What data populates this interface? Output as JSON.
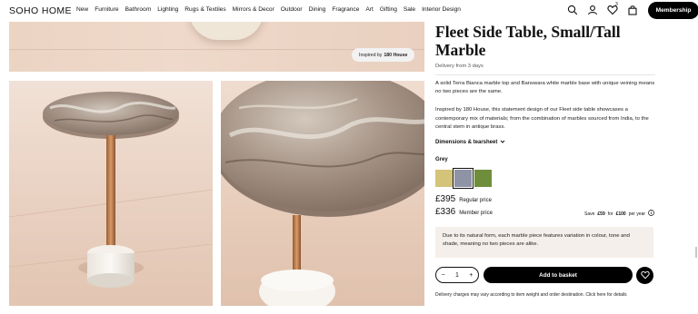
{
  "brand": {
    "logo": "SOHO HOME"
  },
  "nav": [
    "New",
    "Furniture",
    "Bathroom",
    "Lighting",
    "Rugs & Textiles",
    "Mirrors & Decor",
    "Outdoor",
    "Dining",
    "Fragrance",
    "Art",
    "Gifting",
    "Sale",
    "Interior Design"
  ],
  "header_icons": [
    "search-icon",
    "account-icon",
    "wishlist-icon",
    "basket-icon"
  ],
  "basket_count": "3",
  "membership_label": "Membership",
  "gallery": {
    "badge_prefix": "Inspired by",
    "badge_name": "180 House"
  },
  "product": {
    "title": "Fleet Side Table, Small/Tall Marble",
    "delivery": "Delivery from 3 days",
    "description_1": "A solid Terra Bianca marble top and Banswara white marble base with unique veining means no two pieces are the same.",
    "description_2": "Inspired by 180 House, this statement design of our Fleet side table showcases a contemporary mix of materials; from the combination of marbles sourced from India, to the central stem in antique brass.",
    "dimensions_label": "Dimensions & tearsheet",
    "color_label": "Grey",
    "swatches": [
      {
        "name": "swatch-yellow",
        "color": "#d4c47a"
      },
      {
        "name": "swatch-grey",
        "color": "#8f93a6"
      },
      {
        "name": "swatch-green",
        "color": "#6f8e3c"
      }
    ],
    "regular_price": "£395",
    "regular_label": "Regular price",
    "member_price": "£336",
    "member_label": "Member price",
    "save_text": "Save",
    "save_amount": "£59",
    "save_for": "for",
    "save_fee": "£100",
    "save_period": "per year",
    "natural_note": "Due to its natural form, each marble piece features variation in colour, tone and shade, meaning no two pieces are alike.",
    "quantity": "1",
    "add_label": "Add to basket",
    "delivery_note": "Delivery charges may vary according to item weight and order destination. Click here for details"
  }
}
